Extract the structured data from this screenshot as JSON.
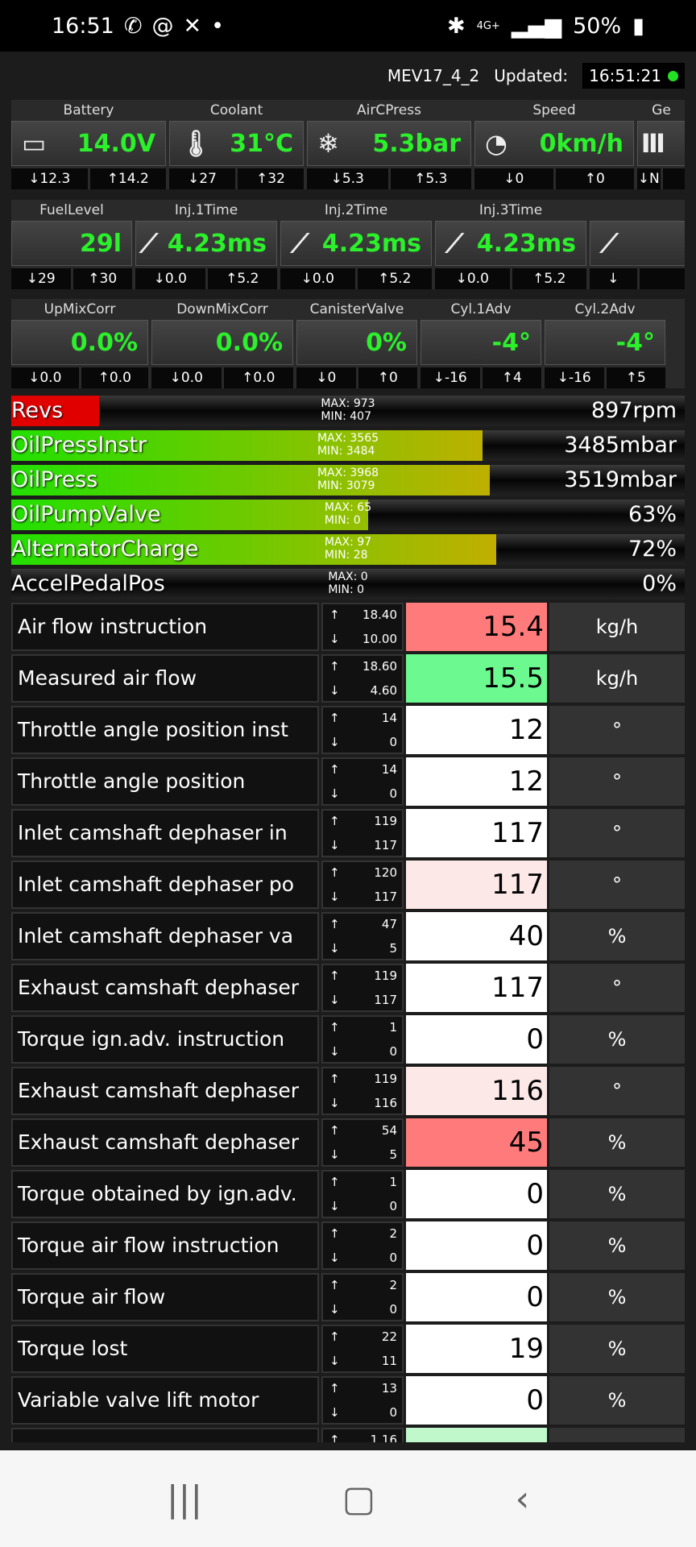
{
  "status_bar": {
    "time": "16:51",
    "icons": [
      "whatsapp-icon",
      "at-icon",
      "activity-icon",
      "dot-icon"
    ],
    "network": "4G+",
    "battery": "50%"
  },
  "header": {
    "ecu": "MEV17_4_2",
    "updated_label": "Updated:",
    "updated_time": "16:51:21",
    "status_color": "#22e022"
  },
  "gauge_rows": [
    [
      {
        "label": "Battery",
        "icon": "battery-icon",
        "value": "14.0V",
        "min": "↓12.3",
        "max": "↑14.2"
      },
      {
        "label": "Coolant",
        "icon": "thermometer-icon",
        "value": "31°C",
        "min": "↓27",
        "max": "↑32"
      },
      {
        "label": "AirCPress",
        "icon": "snowflake-icon",
        "value": "5.3bar",
        "min": "↓5.3",
        "max": "↑5.3"
      },
      {
        "label": "Speed",
        "icon": "speedometer-icon",
        "value": "0km/h",
        "min": "↓0",
        "max": "↑0"
      },
      {
        "label": "Ge",
        "icon": "gear-shift-icon",
        "value": "",
        "min": "↓N",
        "max": ""
      }
    ],
    [
      {
        "label": "FuelLevel",
        "icon": "",
        "value": "29l",
        "min": "↓29",
        "max": "↑30"
      },
      {
        "label": "Inj.1Time",
        "icon": "injector-icon",
        "value": "4.23ms",
        "min": "↓0.0",
        "max": "↑5.2"
      },
      {
        "label": "Inj.2Time",
        "icon": "injector-icon",
        "value": "4.23ms",
        "min": "↓0.0",
        "max": "↑5.2"
      },
      {
        "label": "Inj.3Time",
        "icon": "injector-icon",
        "value": "4.23ms",
        "min": "↓0.0",
        "max": "↑5.2"
      },
      {
        "label": "",
        "icon": "injector-icon",
        "value": "",
        "min": "↓",
        "max": ""
      }
    ],
    [
      {
        "label": "UpMixCorr",
        "icon": "",
        "value": "0.0%",
        "min": "↓0.0",
        "max": "↑0.0"
      },
      {
        "label": "DownMixCorr",
        "icon": "",
        "value": "0.0%",
        "min": "↓0.0",
        "max": "↑0.0"
      },
      {
        "label": "CanisterValve",
        "icon": "",
        "value": "0%",
        "min": "↓0",
        "max": "↑0"
      },
      {
        "label": "Cyl.1Adv",
        "icon": "",
        "value": "-4°",
        "min": "↓-16",
        "max": "↑4"
      },
      {
        "label": "Cyl.2Adv",
        "icon": "",
        "value": "-4°",
        "min": "↓-16",
        "max": "↑5"
      }
    ]
  ],
  "bars": [
    {
      "label": "Revs",
      "max": "MAX: 973",
      "min": "MIN: 407",
      "value": "897rpm",
      "fill_pct": 13,
      "color": "red"
    },
    {
      "label": "OilPressInstr",
      "max": "MAX: 3565",
      "min": "MIN: 3484",
      "value": "3485mbar",
      "fill_pct": 70,
      "color": "gradient"
    },
    {
      "label": "OilPress",
      "max": "MAX: 3968",
      "min": "MIN: 3079",
      "value": "3519mbar",
      "fill_pct": 71,
      "color": "gradient"
    },
    {
      "label": "OilPumpValve",
      "max": "MAX: 65",
      "min": "MIN: 0",
      "value": "63%",
      "fill_pct": 53,
      "color": "gradient"
    },
    {
      "label": "AlternatorCharge",
      "max": "MAX: 97",
      "min": "MIN: 28",
      "value": "72%",
      "fill_pct": 72,
      "color": "gradient"
    },
    {
      "label": "AccelPedalPos",
      "max": "MAX: 0",
      "min": "MIN: 0",
      "value": "0%",
      "fill_pct": 0,
      "color": "gradient"
    }
  ],
  "table": [
    {
      "name": "Air flow instruction",
      "max": "18.40",
      "min": "10.00",
      "value": "15.4",
      "unit": "kg/h",
      "bg": "#ff7b7b"
    },
    {
      "name": "Measured air flow",
      "max": "18.60",
      "min": "4.60",
      "value": "15.5",
      "unit": "kg/h",
      "bg": "#6cf98f"
    },
    {
      "name": "Throttle angle position inst",
      "max": "14",
      "min": "0",
      "value": "12",
      "unit": "°",
      "bg": "#ffffff"
    },
    {
      "name": "Throttle angle position",
      "max": "14",
      "min": "0",
      "value": "12",
      "unit": "°",
      "bg": "#ffffff"
    },
    {
      "name": "Inlet camshaft dephaser in",
      "max": "119",
      "min": "117",
      "value": "117",
      "unit": "°",
      "bg": "#ffffff"
    },
    {
      "name": "Inlet camshaft dephaser po",
      "max": "120",
      "min": "117",
      "value": "117",
      "unit": "°",
      "bg": "#fde8e8"
    },
    {
      "name": "Inlet camshaft dephaser va",
      "max": "47",
      "min": "5",
      "value": "40",
      "unit": "%",
      "bg": "#ffffff"
    },
    {
      "name": "Exhaust camshaft dephaser",
      "max": "119",
      "min": "117",
      "value": "117",
      "unit": "°",
      "bg": "#ffffff"
    },
    {
      "name": "Torque ign.adv. instruction",
      "max": "1",
      "min": "0",
      "value": "0",
      "unit": "%",
      "bg": "#ffffff"
    },
    {
      "name": "Exhaust camshaft dephaser",
      "max": "119",
      "min": "116",
      "value": "116",
      "unit": "°",
      "bg": "#fde8e8"
    },
    {
      "name": "Exhaust camshaft dephaser",
      "max": "54",
      "min": "5",
      "value": "45",
      "unit": "%",
      "bg": "#ff7b7b"
    },
    {
      "name": "Torque obtained by ign.adv.",
      "max": "1",
      "min": "0",
      "value": "0",
      "unit": "%",
      "bg": "#ffffff"
    },
    {
      "name": "Torque air flow instruction",
      "max": "2",
      "min": "0",
      "value": "0",
      "unit": "%",
      "bg": "#ffffff"
    },
    {
      "name": "Torque air flow",
      "max": "2",
      "min": "0",
      "value": "0",
      "unit": "%",
      "bg": "#ffffff"
    },
    {
      "name": "Torque lost",
      "max": "22",
      "min": "11",
      "value": "19",
      "unit": "%",
      "bg": "#ffffff"
    },
    {
      "name": "Variable valve lift motor",
      "max": "13",
      "min": "0",
      "value": "0",
      "unit": "%",
      "bg": "#ffffff"
    },
    {
      "name": "",
      "max": "1.16",
      "min": "",
      "value": "",
      "unit": "",
      "bg": "#c0f8cc"
    }
  ],
  "nav": {
    "icons": [
      "recent-apps-icon",
      "home-icon",
      "back-icon"
    ]
  }
}
